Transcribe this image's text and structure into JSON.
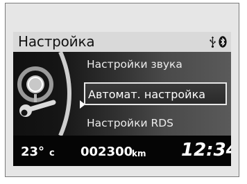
{
  "header": {
    "title": "Настройка"
  },
  "menu": {
    "items": [
      {
        "label": "Настройки звука",
        "selected": false
      },
      {
        "label": "Автомат. настройка",
        "selected": true
      },
      {
        "label": "Настройки RDS",
        "selected": false
      }
    ]
  },
  "status": {
    "temperature": "23°",
    "temperature_unit": "c",
    "odometer": "002300",
    "odometer_unit": "km",
    "clock": "12:34"
  },
  "icons": {
    "header_right": [
      "usb-icon",
      "bluetooth-icon"
    ],
    "left_panel": "microphone-wrench-icon"
  },
  "colors": {
    "header_bg": "#d9d9d9",
    "screen_bg": "#0a0a0a",
    "highlight_border": "#e8e8e8"
  }
}
